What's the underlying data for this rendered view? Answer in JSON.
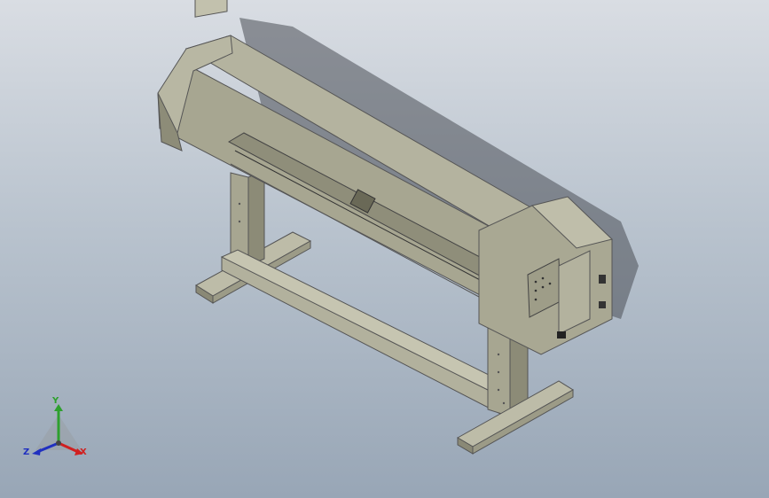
{
  "viewport": {
    "background_top": "#d9dde3",
    "background_bottom": "#98a6b6",
    "model_color": "#a7a691",
    "model_shadow": "#7e7d69",
    "model_highlight": "#c2c1ad"
  },
  "triad": {
    "x_label": "X",
    "y_label": "Y",
    "z_label": "Z",
    "x_color": "#d02020",
    "y_color": "#2ea02e",
    "z_color": "#2030c0"
  }
}
